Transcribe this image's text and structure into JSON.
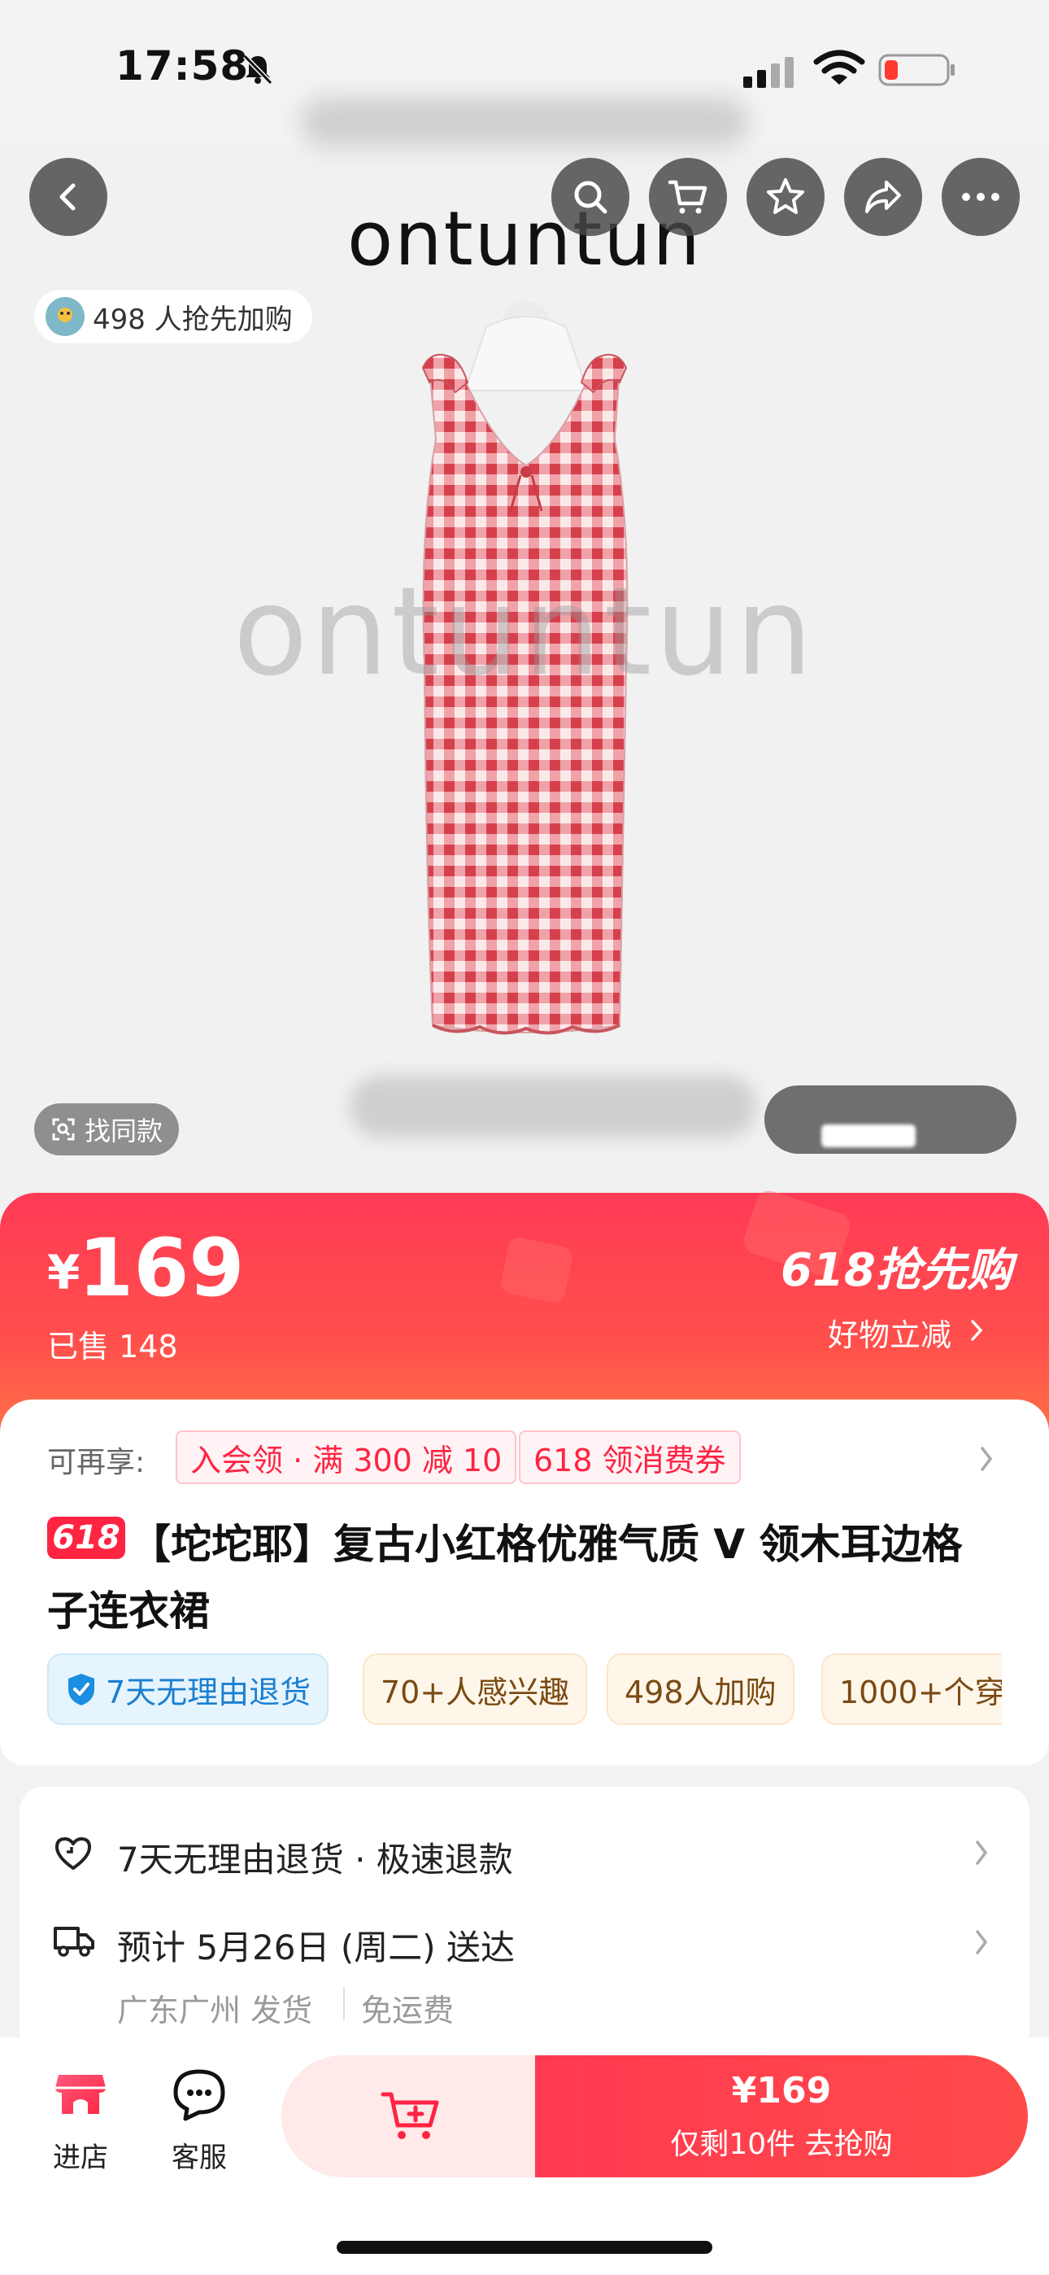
{
  "status_bar": {
    "time": "17:58"
  },
  "hero": {
    "brand_logo_text": "ontuntun",
    "watermark_text": "ontuntun",
    "rush_count_text": "498 人抢先加购",
    "find_similar_label": "找同款"
  },
  "price_banner": {
    "currency": "¥",
    "price": "169",
    "sold": "已售 148",
    "promo_title": "618抢先购",
    "promo_sub": "好物立减"
  },
  "product": {
    "coupon_label": "可再享:",
    "coupons": [
      "入会领 · 满 300 减 10",
      "618 领消费券"
    ],
    "badge": "618",
    "title_line1": "【坨坨耶】复古小红格优雅气质 V 领木耳边格",
    "title_line2": "子连衣裙",
    "tags": {
      "return": "7天无理由退货",
      "interest": "70+人感兴趣",
      "cart": "498人加购",
      "wear": "1000+个穿"
    }
  },
  "service": {
    "return_policy": "7天无理由退货 · 极速退款",
    "delivery": "预计 5月26日 (周二) 送达",
    "ship_from": "广东广州 发货",
    "shipping_fee": "免运费"
  },
  "bottom_bar": {
    "store_label": "进店",
    "service_label": "客服",
    "buy_price": "¥169",
    "buy_sub": "仅剩10件  去抢购"
  },
  "colors": {
    "accent_red": "#ff2442",
    "return_blue": "#1a7fd1",
    "dress_red": "#e0555f"
  }
}
